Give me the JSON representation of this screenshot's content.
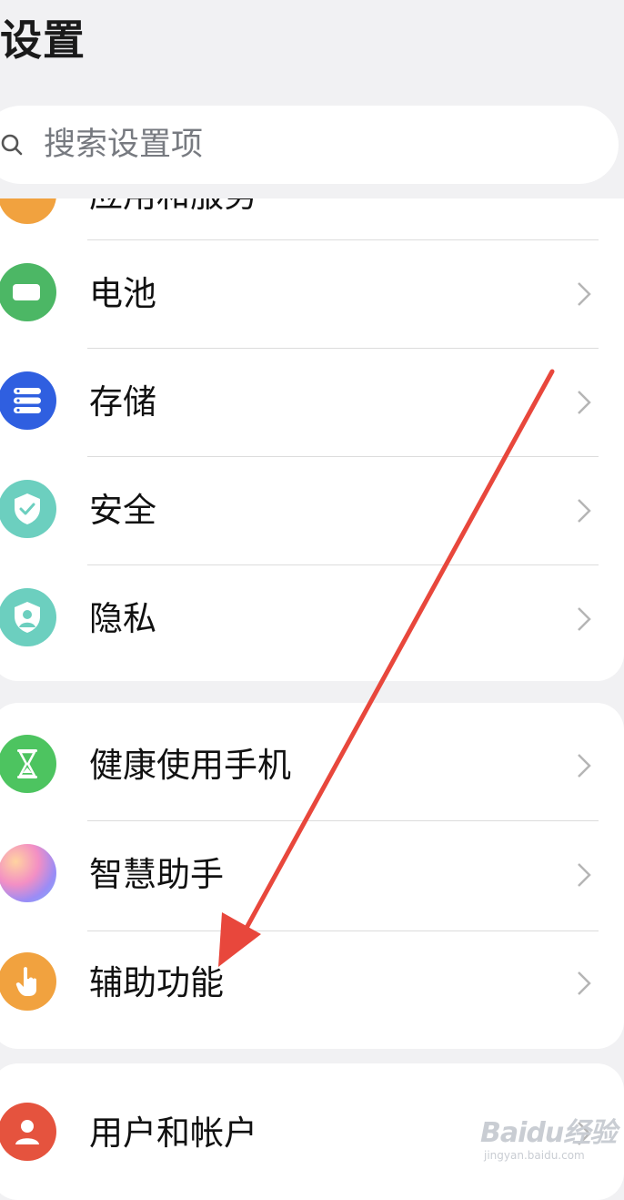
{
  "header": {
    "title": "设置"
  },
  "search": {
    "placeholder": "搜索设置项"
  },
  "group1": {
    "partial_label": "应用和服务",
    "items": [
      {
        "label": "电池",
        "icon": "battery-icon",
        "color": "#4cb765"
      },
      {
        "label": "存储",
        "icon": "storage-icon",
        "color": "#2f5fe0"
      },
      {
        "label": "安全",
        "icon": "shield-check-icon",
        "color": "#6ccfbf"
      },
      {
        "label": "隐私",
        "icon": "privacy-shield-icon",
        "color": "#6ccfbf"
      }
    ]
  },
  "group2": {
    "items": [
      {
        "label": "健康使用手机",
        "icon": "hourglass-icon",
        "color": "#4dc460"
      },
      {
        "label": "智慧助手",
        "icon": "assistant-orb-icon",
        "color": "#b48cf0"
      },
      {
        "label": "辅助功能",
        "icon": "hand-pointer-icon",
        "color": "#f1a23f"
      }
    ]
  },
  "group3": {
    "items": [
      {
        "label": "用户和帐户",
        "icon": "user-icon",
        "color": "#e5533e"
      }
    ]
  },
  "annotation": {
    "arrow_color": "#e8473c"
  },
  "watermark": {
    "brand": "Baidu经验",
    "url": "jingyan.baidu.com"
  }
}
